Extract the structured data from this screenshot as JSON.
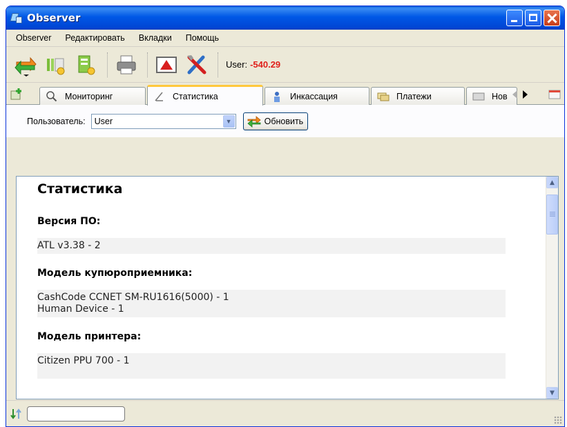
{
  "window": {
    "title": "Observer"
  },
  "menu": [
    "Observer",
    "Редактировать",
    "Вкладки",
    "Помощь"
  ],
  "toolbar": {
    "user_label": "User:",
    "user_balance": "-540.29"
  },
  "tabs": [
    {
      "label": "Мониторинг",
      "icon": "magnifier-icon"
    },
    {
      "label": "Статистика",
      "icon": "pencil-icon",
      "active": true
    },
    {
      "label": "Инкассация",
      "icon": "person-icon"
    },
    {
      "label": "Платежи",
      "icon": "cards-icon"
    },
    {
      "label": "Нов",
      "icon": "card-icon"
    }
  ],
  "filter": {
    "label": "Пользователь:",
    "selected_user": "User",
    "refresh_label": "Обновить"
  },
  "report": {
    "title": "Статистика",
    "sections": [
      {
        "heading": "Версия ПО:",
        "lines": [
          "ATL v3.38 - 2"
        ]
      },
      {
        "heading": "Модель купюроприемника:",
        "lines": [
          "CashCode CCNET SM-RU1616(5000) - 1",
          "Human Device - 1"
        ]
      },
      {
        "heading": "Модель принтера:",
        "lines": [
          "Citizen PPU 700 - 1"
        ]
      }
    ]
  },
  "colors": {
    "balance": "#E0201A",
    "active_tab_accent": "#FFC83C",
    "titlebar": "#0058E6"
  }
}
